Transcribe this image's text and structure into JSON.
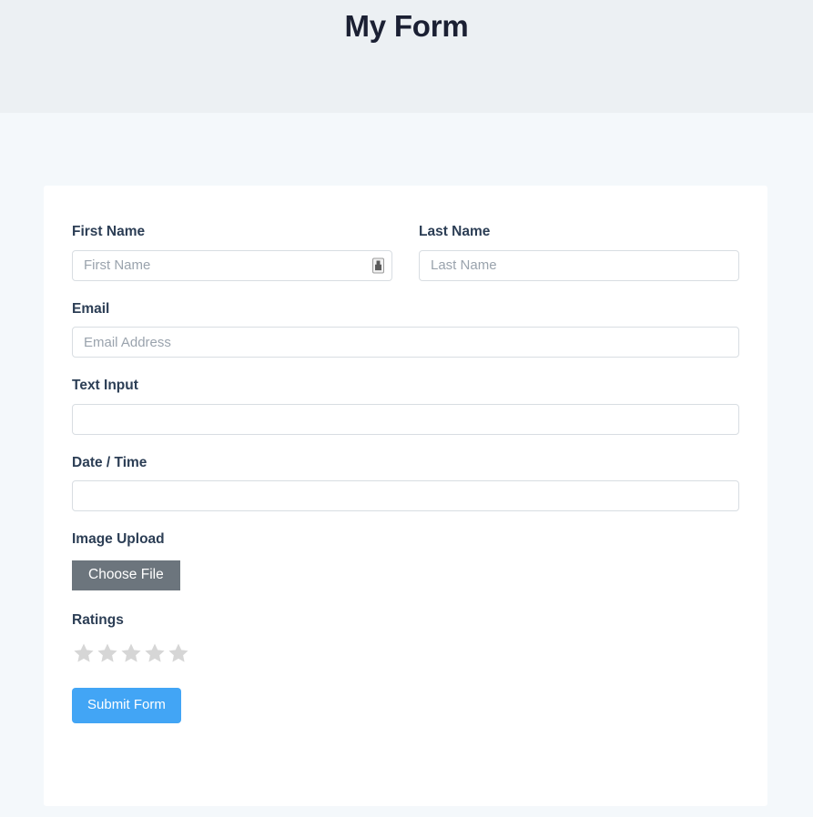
{
  "header": {
    "title": "My Form",
    "background_color": "#ecf0f3"
  },
  "page": {
    "background_color": "#f4f8fb",
    "card_background_color": "#ffffff"
  },
  "form": {
    "fields": [
      {
        "key": "first_name",
        "label": "First Name",
        "placeholder": "First Name",
        "value": "",
        "icon": "autofill-icon"
      },
      {
        "key": "last_name",
        "label": "Last Name",
        "placeholder": "Last Name",
        "value": ""
      },
      {
        "key": "email",
        "label": "Email",
        "placeholder": "Email Address",
        "value": ""
      },
      {
        "key": "text_input",
        "label": "Text Input",
        "placeholder": "",
        "value": ""
      },
      {
        "key": "date_time",
        "label": "Date / Time",
        "placeholder": "",
        "value": ""
      }
    ],
    "image_upload": {
      "label": "Image Upload",
      "button_label": "Choose File",
      "button_color": "#6c757d"
    },
    "ratings": {
      "label": "Ratings",
      "max": 5,
      "value": 0,
      "empty_color": "#d6d6d6",
      "filled_color": "#f5b301"
    },
    "submit": {
      "label": "Submit Form",
      "color": "#42a5f5"
    }
  }
}
